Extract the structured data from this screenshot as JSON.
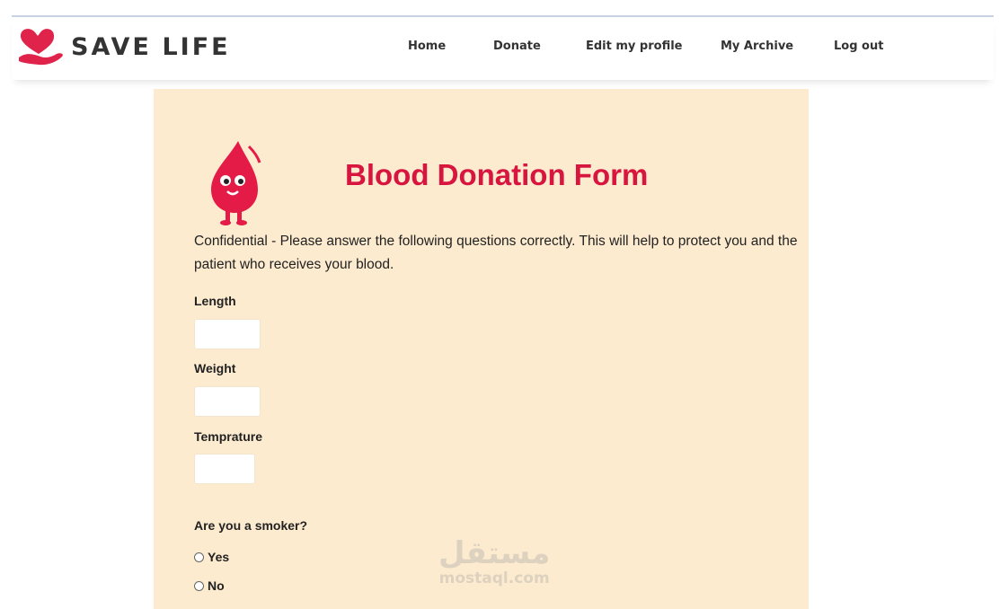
{
  "brand": {
    "part1": "SAVE",
    "part2": "LIFE",
    "accent": "#d7153f"
  },
  "nav": [
    {
      "label": "Home"
    },
    {
      "label": "Donate"
    },
    {
      "label": "Edit my profile"
    },
    {
      "label": "My Archive"
    },
    {
      "label": "Log out"
    }
  ],
  "form": {
    "title": "Blood Donation Form",
    "intro": "Confidential - Please answer the following questions correctly. This will help to protect you and the patient who receives your blood.",
    "fields": [
      {
        "label": "Length",
        "value": ""
      },
      {
        "label": "Weight",
        "value": ""
      },
      {
        "label": "Temprature",
        "value": ""
      }
    ],
    "smoker": {
      "question": "Are you a smoker?",
      "options": [
        "Yes",
        "No"
      ],
      "selected": null
    },
    "background": "#fdebcf"
  },
  "watermark": {
    "arabic": "مستقل",
    "latin": "mostaql.com"
  }
}
